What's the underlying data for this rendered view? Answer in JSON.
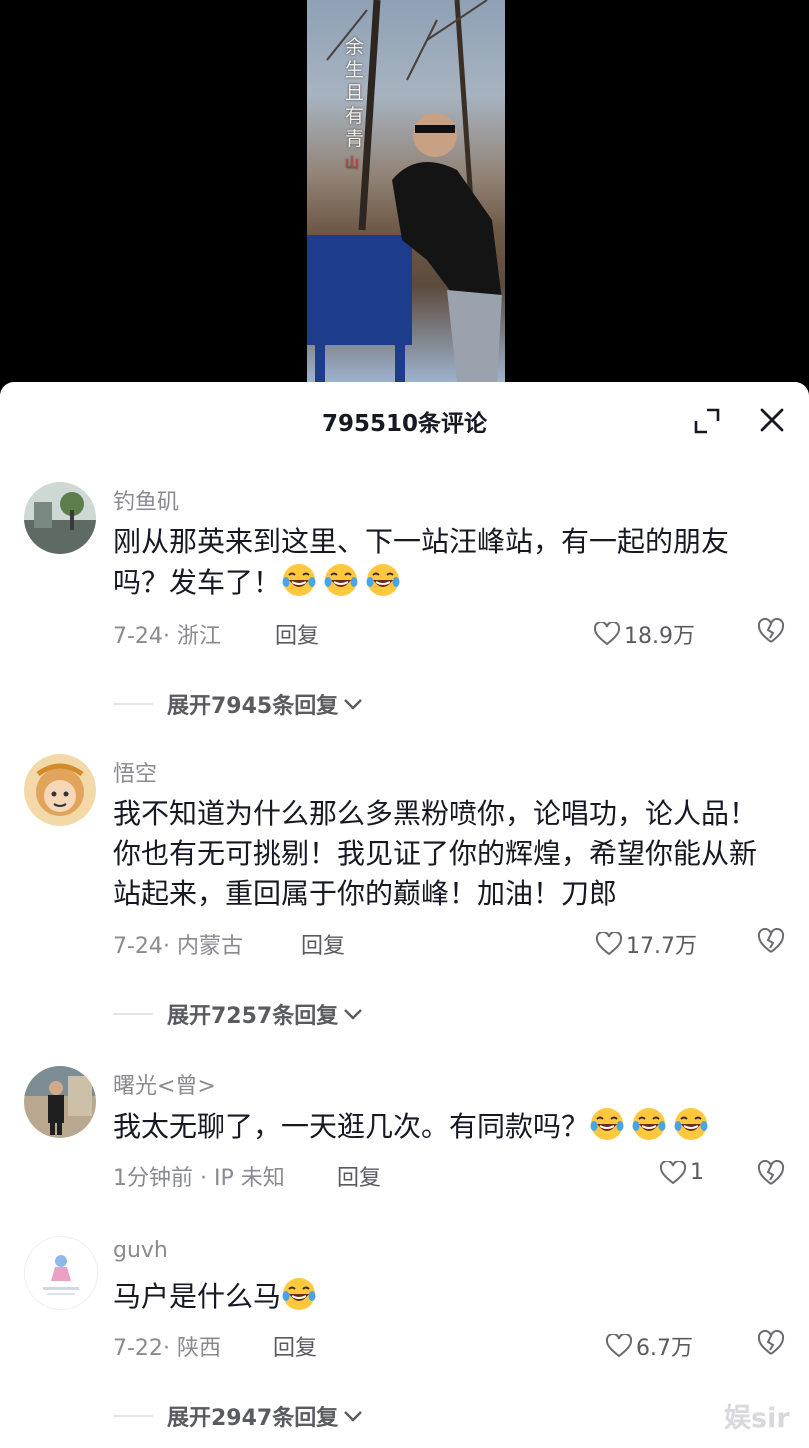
{
  "video": {
    "overlay_text": "余生且有青",
    "overlay_red": "山"
  },
  "header": {
    "comment_count": "795510条评论"
  },
  "comments": [
    {
      "username": "钓鱼矶",
      "text": "刚从那英来到这里、下一站汪峰站，有一起的朋友吗？发车了！",
      "emojis": 3,
      "date": "7-24",
      "location": "浙江",
      "reply_label": "回复",
      "likes": "18.9万",
      "expand_label": "展开7945条回复"
    },
    {
      "username": "悟空",
      "text": "我不知道为什么那么多黑粉喷你，论唱功，论人品！你也有无可挑剔！我见证了你的辉煌，希望你能从新站起来，重回属于你的巅峰！加油！刀郎",
      "emojis": 0,
      "date": "7-24",
      "location": "内蒙古",
      "reply_label": "回复",
      "likes": "17.7万",
      "expand_label": "展开7257条回复"
    },
    {
      "username": "曙光<曾>",
      "text": "我太无聊了，一天逛几次。有同款吗？",
      "emojis": 3,
      "date": "1分钟前",
      "location": "IP 未知",
      "reply_label": "回复",
      "likes": "1",
      "expand_label": ""
    },
    {
      "username": "guvh",
      "text": "马户是什么马",
      "emojis": 1,
      "date": "7-22",
      "location": "陕西",
      "reply_label": "回复",
      "likes": "6.7万",
      "expand_label": "展开2947条回复"
    }
  ],
  "watermark": "娱sir",
  "colors": {
    "primary_text": "#161823",
    "secondary_text": "#8a8b91",
    "emoji_yellow": "#ffc83d"
  }
}
